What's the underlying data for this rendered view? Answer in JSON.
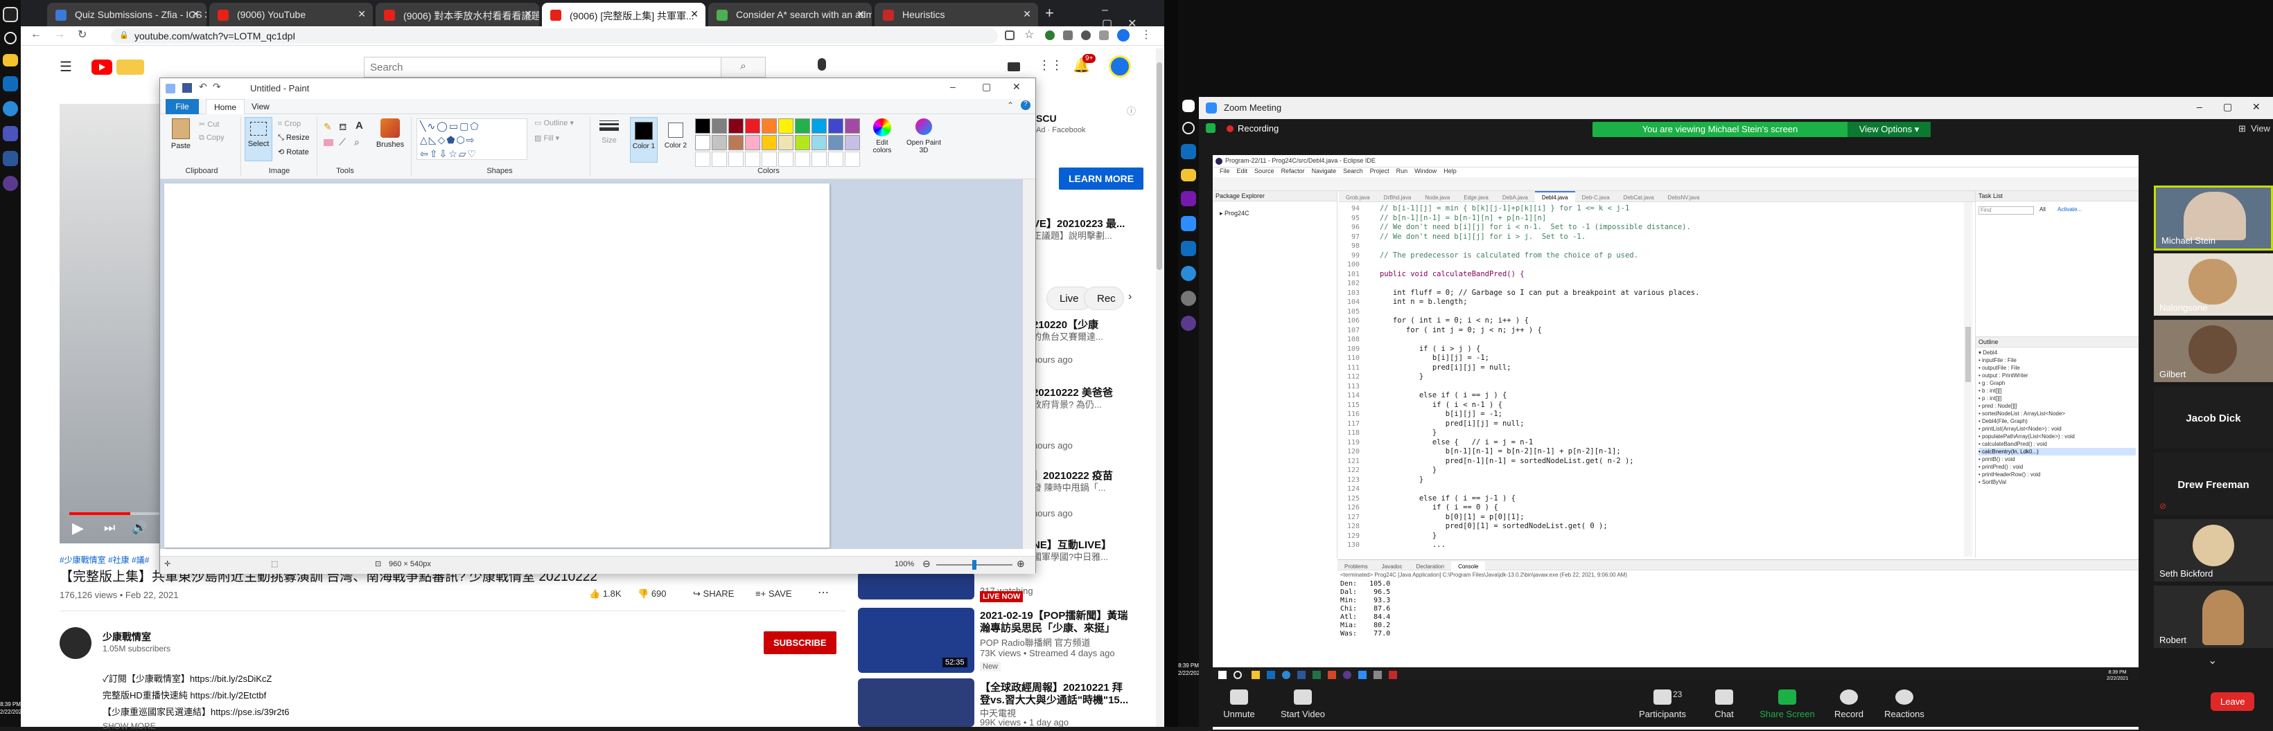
{
  "chrome": {
    "tabs": [
      {
        "label": "Quiz Submissions - Zfia - ICS 3",
        "color": "#3b7bd6"
      },
      {
        "label": "(9006) YouTube",
        "color": "#e62117"
      },
      {
        "label": "(9006) 對本季放水村看看看議題",
        "color": "#e62117"
      },
      {
        "label": "(9006) [完整版上集] 共軍軍...",
        "color": "#e62117"
      },
      {
        "label": "Consider A* search with an adm",
        "color": "#4caf50"
      },
      {
        "label": "Heuristics",
        "color": "#c62828"
      }
    ],
    "new_tab": "+",
    "url": "youtube.com/watch?v=LOTM_qc1dpI"
  },
  "youtube": {
    "search_placeholder": "Search",
    "notification_count": "9+",
    "video_title": "【完整版上集】共軍東沙島附近主動挑釁演訓 台灣、南海戰爭點審訊? 少康戰情室 20210222",
    "hashtags": "#少康戰情室 #社康 #議#",
    "views_date": "176,126 views • Feb 22, 2021",
    "likes": "1.8K",
    "dislikes": "690",
    "share": "SHARE",
    "save": "SAVE",
    "channel_name": "少康戰情室",
    "subscribers": "1.05M subscribers",
    "subscribe": "SUBSCRIBE",
    "desc_lines": [
      "✓訂閱【少康戰情室】https://bit.ly/2sDiKcZ",
      "完整版HD重播快速純 https://bit.ly/2Etctbf",
      "【少康重巡國家民選連結】https://pse.is/39r2t6"
    ],
    "show_more": "SHOW MORE",
    "ad_sub": "Ad · Facebook",
    "ad_title": "SCU",
    "learn_more": "LEARN MORE",
    "chips": [
      "Live",
      "Rec"
    ],
    "side_items": [
      {
        "title": "VE】20210223 最...",
        "meta": "正議題】說明擊劃..."
      },
      {
        "title": "210220【少康",
        "meta": "的魚台又賽爾達..."
      },
      {
        "title": "",
        "meta": "hours ago"
      },
      {
        "title": "20210222 美爸爸",
        "meta": "政府背景? 為仍..."
      },
      {
        "title": "",
        "meta": "hours ago"
      },
      {
        "title": "】20210222 疫苗",
        "meta": "發 陳時中甩鍋「..."
      },
      {
        "title": "",
        "meta": "hours ago"
      },
      {
        "title": "NE】互動LIVE】",
        "meta": "國軍學國?中日雅..."
      },
      {
        "title": "",
        "meta": "317 watching"
      }
    ],
    "live_now": "LIVE NOW",
    "side_video_2": {
      "title": "2021-02-19【POP擂新聞】黃瑞",
      "sub": "瀚專訪吳思民「少康、來挺」",
      "meta1": "POP Radio聯播網 官方頻道",
      "meta2": "73K views • Streamed 4 days ago",
      "badge": "New",
      "duration": "52:35"
    },
    "side_video_3": {
      "title": "【全球政經周報】20210221 拜",
      "sub": "登vs.習大大與少通話\"時機\"15...",
      "meta1": "中天電視",
      "meta2": "99K views • 1 day ago"
    }
  },
  "paint": {
    "title": "Untitled - Paint",
    "menu": [
      "File",
      "Home",
      "View"
    ],
    "groups": [
      "Clipboard",
      "Image",
      "Tools",
      "Shapes",
      "Colors"
    ],
    "clipboard": {
      "paste": "Paste",
      "cut": "Cut",
      "copy": "Copy"
    },
    "image": {
      "select": "Select",
      "crop": "Crop",
      "resize": "Resize",
      "rotate": "Rotate"
    },
    "brushes": "Brushes",
    "outline": "Outline",
    "fill": "Fill",
    "size": "Size",
    "color1": "Color 1",
    "color2": "Color 2",
    "edit_colors": "Edit colors",
    "open_paint3d": "Open Paint 3D",
    "palette": [
      "#000000",
      "#7f7f7f",
      "#880015",
      "#ed1c24",
      "#ff7f27",
      "#fff200",
      "#22b14c",
      "#00a2e8",
      "#3f48cc",
      "#a349a4",
      "#ffffff",
      "#c3c3c3",
      "#b97a57",
      "#ffaec9",
      "#ffc90e",
      "#efe4b0",
      "#b5e61d",
      "#99d9ea",
      "#7092be",
      "#c8bfe7"
    ],
    "status_size": "960 × 540px",
    "zoom": "100%"
  },
  "zoom": {
    "title": "Zoom Meeting",
    "recording": "Recording",
    "viewing_banner": "You are viewing Michael Stein's screen",
    "view_options": "View Options",
    "view": "View",
    "participants": [
      {
        "name": "Michael Stein",
        "has_video": true
      },
      {
        "name": "Nalongsone",
        "has_video": true
      },
      {
        "name": "Gilbert",
        "has_video": true
      },
      {
        "name": "Jacob Dick",
        "has_video": false
      },
      {
        "name": "Drew Freeman",
        "has_video": false
      },
      {
        "name": "Seth Bickford",
        "has_video": true
      },
      {
        "name": "Robert",
        "has_video": true
      }
    ],
    "controls": [
      "Unmute",
      "Start Video",
      "Participants",
      "Chat",
      "Share Screen",
      "Record",
      "Reactions"
    ],
    "participant_count": "23",
    "leave": "Leave"
  },
  "eclipse": {
    "title": "Program-22/11 - Prog24C/src/Debl4.java - Eclipse IDE",
    "menu": [
      "File",
      "Edit",
      "Source",
      "Refactor",
      "Navigate",
      "Search",
      "Project",
      "Run",
      "Window",
      "Help"
    ],
    "package_explorer": "Package Explorer",
    "project": "Prog24C",
    "editor_tabs": [
      "Grob.java",
      "DrBhd.java",
      "Node.java",
      "Edge.java",
      "DebA.java",
      "Debl4.java",
      "Deb-C.java",
      "DebCat.java",
      "DebsNV.java"
    ],
    "code": [
      {
        "n": "94",
        "t": "   // b[i-1][j] = min { b[k][j-1]+p[k][i] } for 1 <= k < j-1"
      },
      {
        "n": "95",
        "t": "   // b[n-1][n-1] = b[n-1][n] + p[n-1][n]"
      },
      {
        "n": "96",
        "t": "   // We don't need b[i][j] for i < n-1.  Set to -1 (impossible distance)."
      },
      {
        "n": "97",
        "t": "   // We don't need b[i][j] for i > j.  Set to -1."
      },
      {
        "n": "98",
        "t": ""
      },
      {
        "n": "99",
        "t": "   // The predecessor is calculated from the choice of p used."
      },
      {
        "n": "100",
        "t": ""
      },
      {
        "n": "101",
        "t": "   public void calculateBandPred() {"
      },
      {
        "n": "102",
        "t": ""
      },
      {
        "n": "103",
        "t": "      int fluff = 0; // Garbage so I can put a breakpoint at various places."
      },
      {
        "n": "104",
        "t": "      int n = b.length;"
      },
      {
        "n": "105",
        "t": ""
      },
      {
        "n": "106",
        "t": "      for ( int i = 0; i < n; i++ ) {"
      },
      {
        "n": "107",
        "t": "         for ( int j = 0; j < n; j++ ) {"
      },
      {
        "n": "108",
        "t": ""
      },
      {
        "n": "109",
        "t": "            if ( i > j ) {"
      },
      {
        "n": "110",
        "t": "               b[i][j] = -1;"
      },
      {
        "n": "111",
        "t": "               pred[i][j] = null;"
      },
      {
        "n": "112",
        "t": "            }"
      },
      {
        "n": "113",
        "t": ""
      },
      {
        "n": "114",
        "t": "            else if ( i == j ) {"
      },
      {
        "n": "115",
        "t": "               if ( i < n-1 ) {"
      },
      {
        "n": "116",
        "t": "                  b[i][j] = -1;"
      },
      {
        "n": "117",
        "t": "                  pred[i][j] = null;"
      },
      {
        "n": "118",
        "t": "               }"
      },
      {
        "n": "119",
        "t": "               else {   // i = j = n-1"
      },
      {
        "n": "120",
        "t": "                  b[n-1][n-1] = b[n-2][n-1] + p[n-2][n-1];"
      },
      {
        "n": "121",
        "t": "                  pred[n-1][n-1] = sortedNodeList.get( n-2 );"
      },
      {
        "n": "122",
        "t": "               }"
      },
      {
        "n": "123",
        "t": "            }"
      },
      {
        "n": "124",
        "t": ""
      },
      {
        "n": "125",
        "t": "            else if ( i == j-1 ) {"
      },
      {
        "n": "126",
        "t": "               if ( i == 0 ) {"
      },
      {
        "n": "127",
        "t": "                  b[0][1] = p[0][1];"
      },
      {
        "n": "128",
        "t": "                  pred[0][1] = sortedNodeList.get( 0 );"
      },
      {
        "n": "129",
        "t": "               }"
      },
      {
        "n": "130",
        "t": "               ..."
      }
    ],
    "task_list": "Task List",
    "find": "Find",
    "all": "All",
    "activate": "Activate...",
    "outline_title": "Outline",
    "outline_items": [
      "Debl4",
      "inputFile : File",
      "outputFile : File",
      "output : PrintWriter",
      "g : Graph",
      "b : int[][]",
      "p : int[][]",
      "pred : Node[][]",
      "sortedNodeList : ArrayList<Node>",
      "Debl4(File, Graph)",
      "printList(ArrayList<Node>) : void",
      "populatePathArray(List<Node>) : void",
      "calculateBandPred() : void",
      "calcBnentry(ln, Ldk0...)",
      "printB() : void",
      "printPred() : void",
      "printHeaderRow() : void",
      "SortByVal"
    ],
    "bottom_tabs": [
      "Problems",
      "Javadoc",
      "Declaration",
      "Console"
    ],
    "console_header": "<terminated> Prog24C [Java Application] C:\\Program Files\\Java\\jdk-13.0.2\\bin\\javaw.exe (Feb 22, 2021, 9:06:00 AM)",
    "console_lines": [
      "Den:   105.0",
      "Dal:    96.5",
      "Min:    93.3",
      "Chi:    87.6",
      "Atl:    84.4",
      "Mia:    80.2",
      "Was:    77.0"
    ]
  },
  "taskbar_left": {
    "time": "8:39 PM",
    "date": "2/22/2021"
  },
  "taskbar_right": {
    "time": "8:39 PM",
    "date": "2/22/2021"
  },
  "inner_taskbar": {
    "time": "8:39 PM",
    "date": "2/22/2021"
  },
  "colors": {
    "zoom_green": "#1bb146",
    "zoom_blue": "#0e72ed",
    "leave_red": "#e02828",
    "yt_red": "#cc0000",
    "eclipse_purple": "#8a2d6e"
  }
}
